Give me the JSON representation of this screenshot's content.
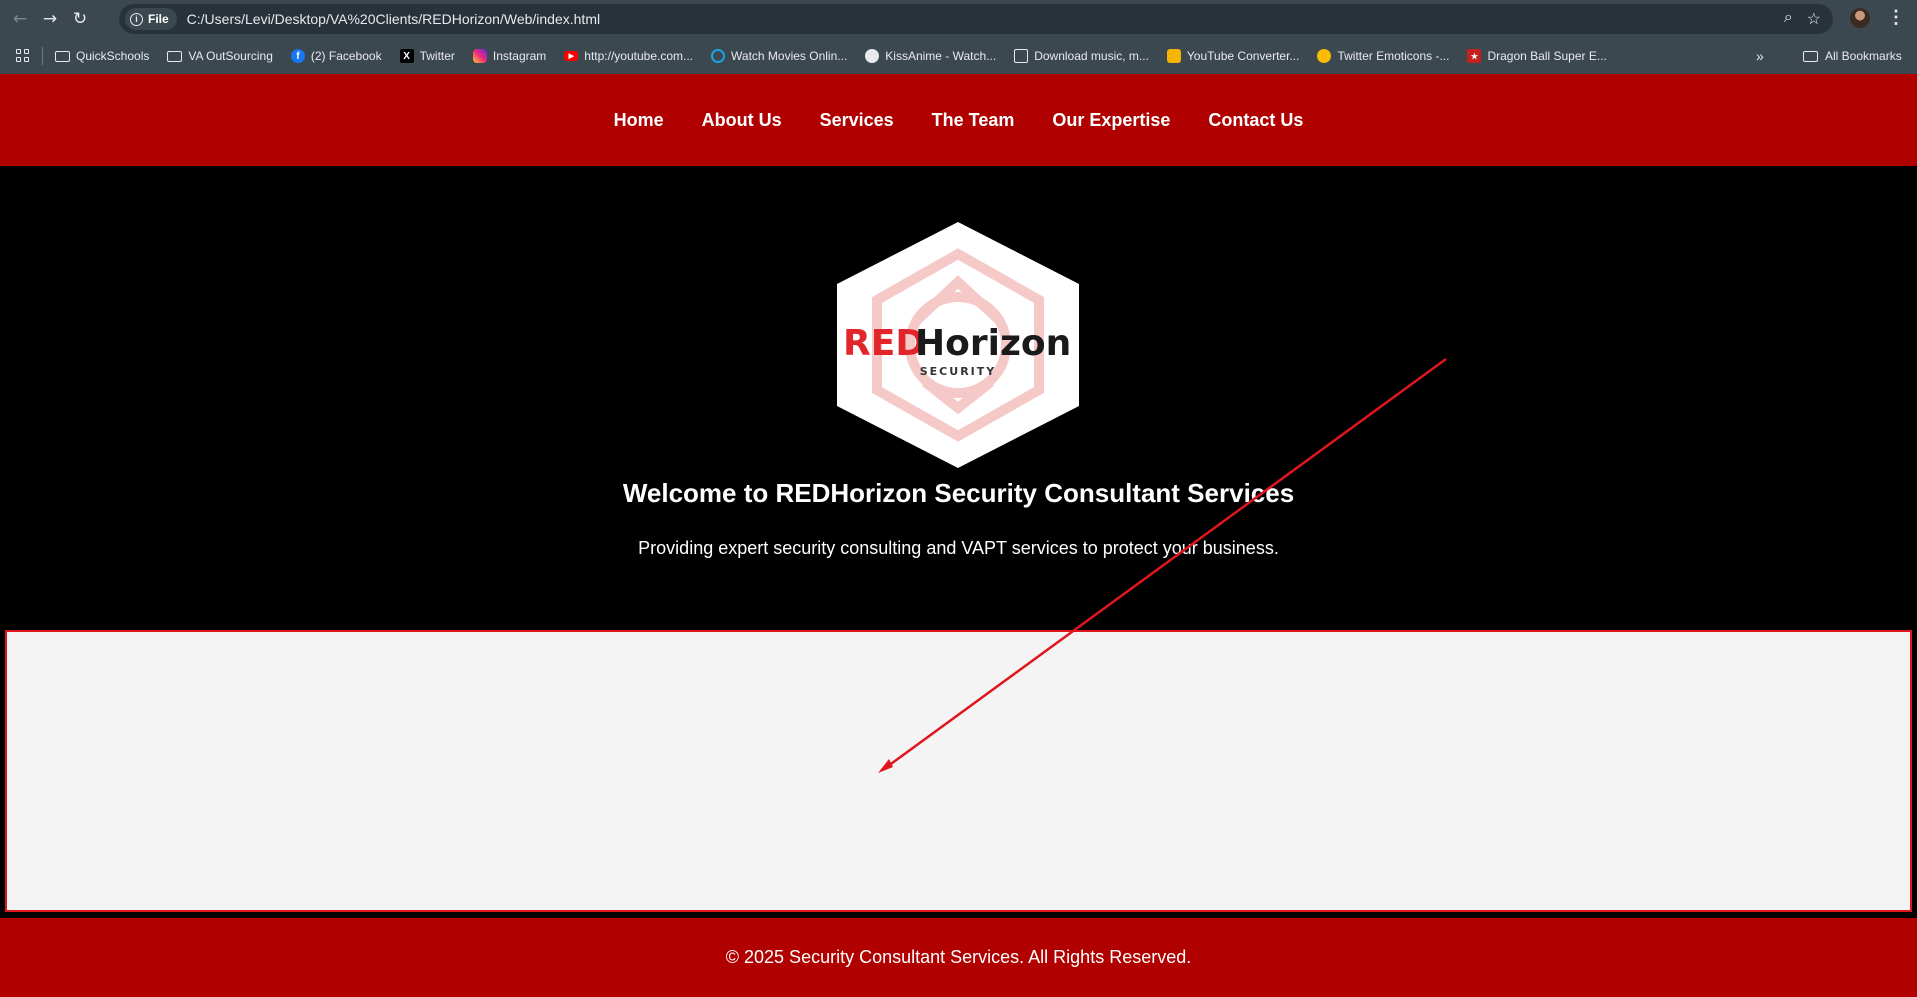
{
  "browser": {
    "url_chip": "File",
    "url": "C:/Users/Levi/Desktop/VA%20Clients/REDHorizon/Web/index.html",
    "bookmarks": [
      {
        "label": "QuickSchools",
        "icon": "folder-icon"
      },
      {
        "label": "VA OutSourcing",
        "icon": "folder-icon"
      },
      {
        "label": "(2) Facebook",
        "icon": "facebook-icon"
      },
      {
        "label": "Twitter",
        "icon": "x-icon"
      },
      {
        "label": "Instagram",
        "icon": "instagram-icon"
      },
      {
        "label": "http://youtube.com...",
        "icon": "youtube-icon"
      },
      {
        "label": "Watch Movies Onlin...",
        "icon": "globe-icon"
      },
      {
        "label": "KissAnime - Watch...",
        "icon": "kissanime-icon"
      },
      {
        "label": "Download music, m...",
        "icon": "monitor-icon"
      },
      {
        "label": "YouTube Converter...",
        "icon": "converter-icon"
      },
      {
        "label": "Twitter Emoticons -...",
        "icon": "emoji-icon"
      },
      {
        "label": "Dragon Ball Super E...",
        "icon": "dragonball-icon"
      }
    ],
    "all_bookmarks": "All Bookmarks"
  },
  "site": {
    "nav": [
      "Home",
      "About Us",
      "Services",
      "The Team",
      "Our Expertise",
      "Contact Us"
    ],
    "logo": {
      "red": "RED",
      "dark": "Horizon",
      "tag": "SECURITY"
    },
    "hero_title": "Welcome to REDHorizon Security Consultant Services",
    "hero_subtitle": "Providing expert security consulting and VAPT services to protect your business.",
    "footer": "© 2025 Security Consultant Services. All Rights Reserved."
  },
  "colors": {
    "brand_red": "#b00000",
    "annotation_red": "#e0161e",
    "content_bg": "#f4f4f4",
    "hero_bg": "#000000"
  }
}
